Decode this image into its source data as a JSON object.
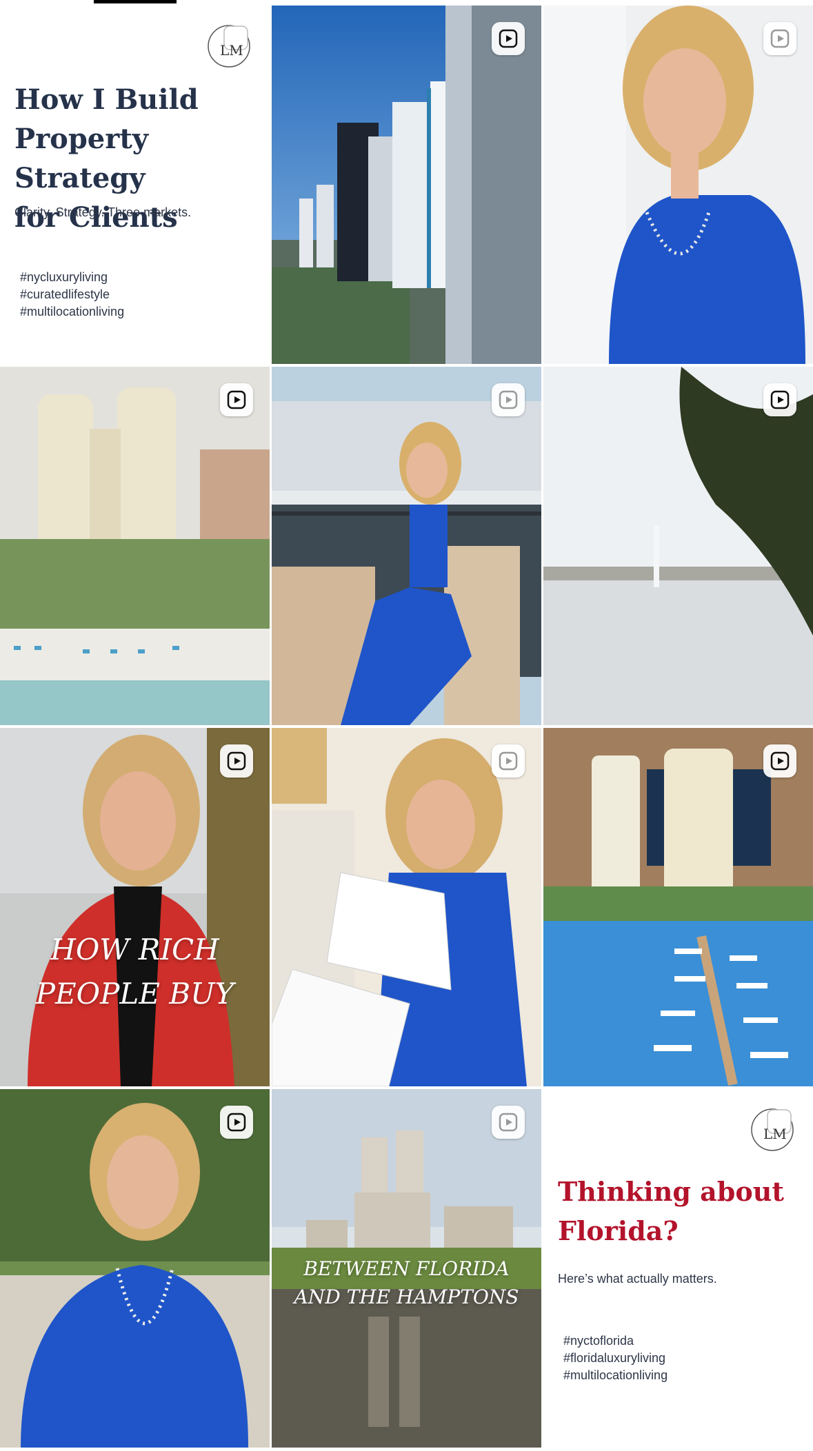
{
  "profile_grid": {
    "posts": [
      {
        "kind": "text-card",
        "title": "How I Build Property Strategy for Clients",
        "subtitle": "Clarity. Strategy. Three markets.",
        "hashtags": [
          "#nycluxuryliving",
          "#curatedlifestyle",
          "#multilocationliving"
        ],
        "logo_text": "LM",
        "title_color": "#25324a"
      },
      {
        "kind": "reel",
        "scene": "miami-towers",
        "icon": "reel-icon"
      },
      {
        "kind": "reel",
        "scene": "portrait-blue-dress",
        "icon": "reel-icon"
      },
      {
        "kind": "reel",
        "scene": "development-model",
        "icon": "reel-icon"
      },
      {
        "kind": "reel",
        "scene": "marina-phone-call",
        "icon": "reel-icon"
      },
      {
        "kind": "reel",
        "scene": "lake-fountain",
        "icon": "reel-icon"
      },
      {
        "kind": "reel",
        "scene": "red-blazer-portrait",
        "icon": "reel-icon",
        "overlay": "HOW RICH PEOPLE BUY"
      },
      {
        "kind": "reel",
        "scene": "reading-documents",
        "icon": "reel-icon"
      },
      {
        "kind": "reel",
        "scene": "marina-model",
        "icon": "reel-icon"
      },
      {
        "kind": "reel",
        "scene": "garden-portrait",
        "icon": "reel-icon"
      },
      {
        "kind": "reel",
        "scene": "central-park-skyline",
        "icon": "reel-icon",
        "overlay": "BETWEEN FLORIDA AND THE HAMPTONS"
      },
      {
        "kind": "text-card",
        "title": "Thinking about Florida?",
        "subtitle": "Here’s what actually matters.",
        "hashtags": [
          "#nyctoflorida",
          "#floridaluxuryliving",
          "#multilocationliving"
        ],
        "logo_text": "LM",
        "title_color": "#b3132b"
      }
    ]
  },
  "overlays": {
    "rich_line1": "HOW RICH",
    "rich_line2": "PEOPLE BUY",
    "between_line1": "BETWEEN FLORIDA",
    "between_line2": "AND THE HAMPTONS"
  },
  "card1": {
    "title_line1": "How I Build",
    "title_line2": "Property Strategy",
    "title_line3": "for Clients",
    "subtitle": "Clarity. Strategy. Three markets.",
    "tag1": "#nycluxuryliving",
    "tag2": "#curatedlifestyle",
    "tag3": "#multilocationliving"
  },
  "card2": {
    "title_line1": "Thinking about",
    "title_line2": "Florida?",
    "subtitle": "Here’s what actually matters.",
    "tag1": "#nyctoflorida",
    "tag2": "#floridaluxuryliving",
    "tag3": "#multilocationliving"
  },
  "colors": {
    "title_navy": "#25324a",
    "title_red": "#b3132b",
    "dress_blue": "#1f55c9"
  }
}
